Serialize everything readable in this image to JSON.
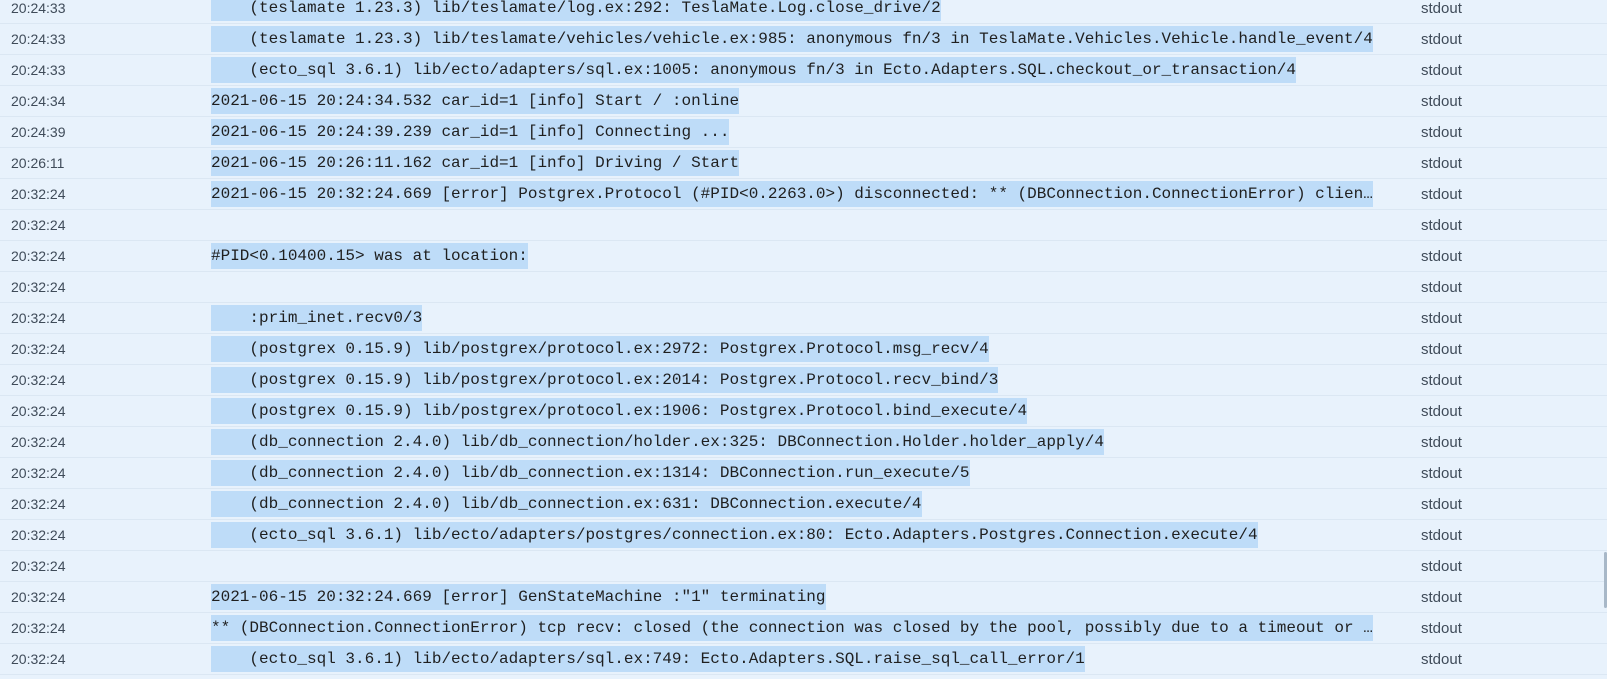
{
  "log": {
    "rows": [
      {
        "time": "20:24:33",
        "message": "    (teslamate 1.23.3) lib/teslamate/log.ex:292: TeslaMate.Log.close_drive/2",
        "stream": "stdout"
      },
      {
        "time": "20:24:33",
        "message": "    (teslamate 1.23.3) lib/teslamate/vehicles/vehicle.ex:985: anonymous fn/3 in TeslaMate.Vehicles.Vehicle.handle_event/4",
        "stream": "stdout"
      },
      {
        "time": "20:24:33",
        "message": "    (ecto_sql 3.6.1) lib/ecto/adapters/sql.ex:1005: anonymous fn/3 in Ecto.Adapters.SQL.checkout_or_transaction/4",
        "stream": "stdout"
      },
      {
        "time": "20:24:34",
        "message": "2021-06-15 20:24:34.532 car_id=1 [info] Start / :online",
        "stream": "stdout"
      },
      {
        "time": "20:24:39",
        "message": "2021-06-15 20:24:39.239 car_id=1 [info] Connecting ...",
        "stream": "stdout"
      },
      {
        "time": "20:26:11",
        "message": "2021-06-15 20:26:11.162 car_id=1 [info] Driving / Start",
        "stream": "stdout"
      },
      {
        "time": "20:32:24",
        "message": "2021-06-15 20:32:24.669 [error] Postgrex.Protocol (#PID<0.2263.0>) disconnected: ** (DBConnection.ConnectionError) clien…",
        "stream": "stdout"
      },
      {
        "time": "20:32:24",
        "message": "",
        "stream": "stdout"
      },
      {
        "time": "20:32:24",
        "message": "#PID<0.10400.15> was at location:",
        "stream": "stdout"
      },
      {
        "time": "20:32:24",
        "message": "",
        "stream": "stdout"
      },
      {
        "time": "20:32:24",
        "message": "    :prim_inet.recv0/3",
        "stream": "stdout"
      },
      {
        "time": "20:32:24",
        "message": "    (postgrex 0.15.9) lib/postgrex/protocol.ex:2972: Postgrex.Protocol.msg_recv/4",
        "stream": "stdout"
      },
      {
        "time": "20:32:24",
        "message": "    (postgrex 0.15.9) lib/postgrex/protocol.ex:2014: Postgrex.Protocol.recv_bind/3",
        "stream": "stdout"
      },
      {
        "time": "20:32:24",
        "message": "    (postgrex 0.15.9) lib/postgrex/protocol.ex:1906: Postgrex.Protocol.bind_execute/4",
        "stream": "stdout"
      },
      {
        "time": "20:32:24",
        "message": "    (db_connection 2.4.0) lib/db_connection/holder.ex:325: DBConnection.Holder.holder_apply/4",
        "stream": "stdout"
      },
      {
        "time": "20:32:24",
        "message": "    (db_connection 2.4.0) lib/db_connection.ex:1314: DBConnection.run_execute/5",
        "stream": "stdout"
      },
      {
        "time": "20:32:24",
        "message": "    (db_connection 2.4.0) lib/db_connection.ex:631: DBConnection.execute/4",
        "stream": "stdout"
      },
      {
        "time": "20:32:24",
        "message": "    (ecto_sql 3.6.1) lib/ecto/adapters/postgres/connection.ex:80: Ecto.Adapters.Postgres.Connection.execute/4",
        "stream": "stdout"
      },
      {
        "time": "20:32:24",
        "message": "",
        "stream": "stdout"
      },
      {
        "time": "20:32:24",
        "message": "2021-06-15 20:32:24.669 [error] GenStateMachine :\"1\" terminating",
        "stream": "stdout"
      },
      {
        "time": "20:32:24",
        "message": "** (DBConnection.ConnectionError) tcp recv: closed (the connection was closed by the pool, possibly due to a timeout or …",
        "stream": "stdout"
      },
      {
        "time": "20:32:24",
        "message": "    (ecto_sql 3.6.1) lib/ecto/adapters/sql.ex:749: Ecto.Adapters.SQL.raise_sql_call_error/1",
        "stream": "stdout"
      }
    ]
  }
}
